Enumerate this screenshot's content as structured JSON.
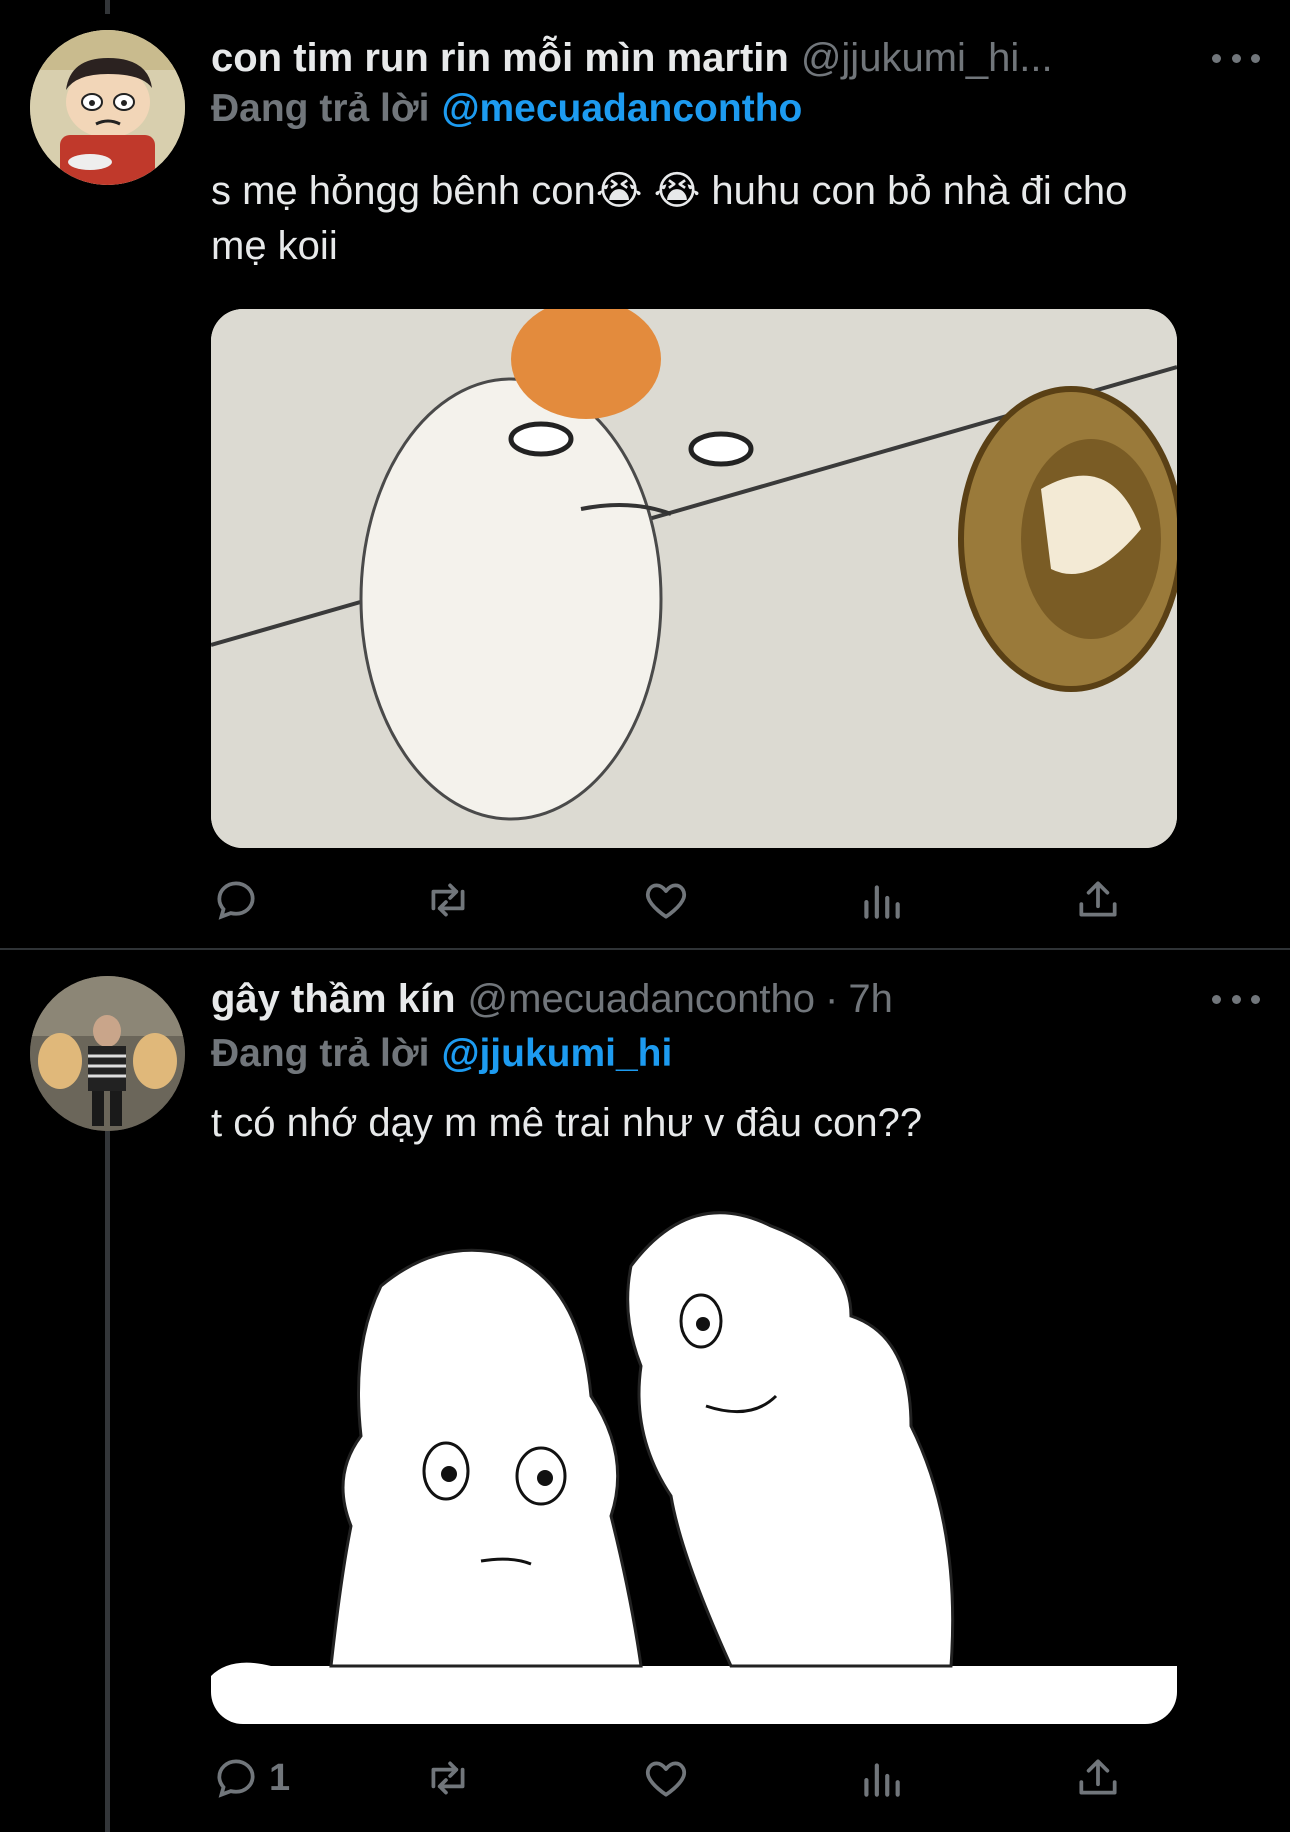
{
  "tweets": [
    {
      "name": "con tim run rin mỗi mìn martin",
      "handle": "@jjukumi_hi...",
      "reply_label": "Đang trả lời",
      "reply_to": "@mecuadancontho",
      "text_line1": "s mẹ hỏngg bênh con😭 😭 huhu con bỏ nhà đi cho",
      "text_line2": "mẹ koii",
      "reply_count": ""
    },
    {
      "name": "gây thầm kín",
      "handle": "@mecuadancontho",
      "separator": "·",
      "time": "7h",
      "reply_label": "Đang trả lời",
      "reply_to": "@jjukumi_hi",
      "text_line1": "t có nhớ dạy m mê trai như v đâu con??",
      "reply_count": "1"
    }
  ],
  "icons": {
    "reply": "reply-icon",
    "retweet": "retweet-icon",
    "like": "like-icon",
    "views": "views-icon",
    "share": "share-icon",
    "more": "more-icon"
  },
  "colors": {
    "background": "#000000",
    "text": "#e7e9ea",
    "secondary": "#71767b",
    "accent": "#1d9bf0",
    "divider": "#2f3336"
  }
}
